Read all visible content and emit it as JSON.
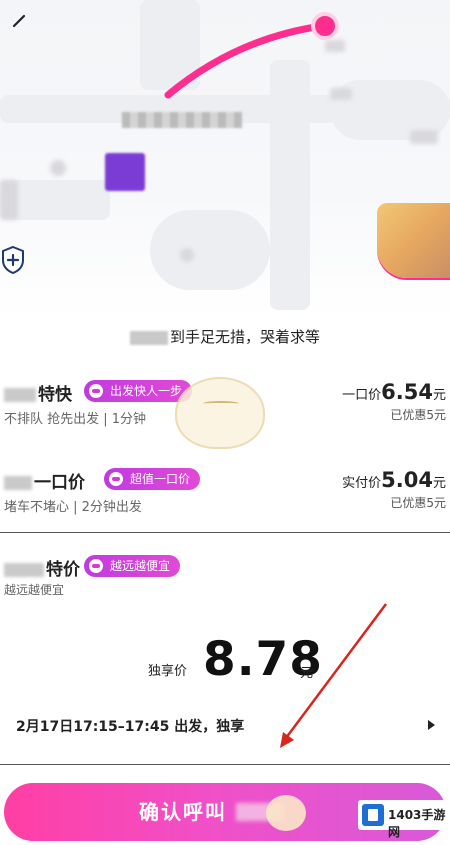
{
  "colors": {
    "accent_pink": "#ff2e8e",
    "tag_purple": "#c13ae0",
    "button_gradient_start": "#ff3fa4",
    "button_gradient_end": "#d85ad8",
    "annotation_arrow": "#d9261c"
  },
  "icons": {
    "back": "back-arrow-icon",
    "shield": "shield-plus-icon",
    "chevron": "chevron-right-icon"
  },
  "status": {
    "text": "到手足无措，哭着求等"
  },
  "options": [
    {
      "title": "特快",
      "tag": "出发快人一步",
      "subtitle": "不排队 抢先出发 | 1分钟",
      "price_prefix": "一口价",
      "price": "6.54",
      "price_unit": "元",
      "discount": "已优惠5元"
    },
    {
      "title": "一口价",
      "tag": "超值一口价",
      "subtitle": "堵车不堵心 | 2分钟出发",
      "price_prefix": "实付价",
      "price": "5.04",
      "price_unit": "元",
      "discount": "已优惠5元"
    }
  ],
  "selected": {
    "title": "特价",
    "tag": "越远越便宜",
    "subtitle": "越远越便宜",
    "price_prefix": "独享价",
    "price": "8.78",
    "price_unit": "元",
    "departure": "2月17日17:15–17:45 出发，独享"
  },
  "confirm": {
    "label": "确认呼叫"
  },
  "watermark": {
    "text": "1403手游网"
  }
}
